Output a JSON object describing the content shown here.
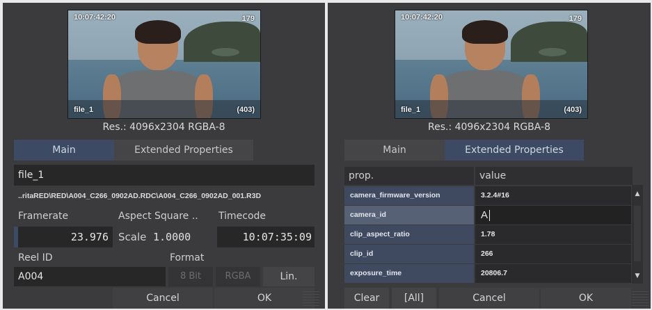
{
  "thumbnail": {
    "timecode": "10:07:42:20",
    "frame": "179",
    "clip_name": "file_1",
    "count": "(403)"
  },
  "resolution": "Res.: 4096x2304 RGBA-8",
  "tabs": {
    "main": "Main",
    "extended": "Extended Properties"
  },
  "main": {
    "clip_name": "file_1",
    "path": "..ritaRED\\RED\\A004_C266_0902AD.RDC\\A004_C266_0902AD_001.R3D",
    "framerate_label": "Framerate",
    "framerate_value": "23.976",
    "aspect_label": "Aspect Square ..",
    "scale_label": "Scale",
    "scale_value": "1.0000",
    "timecode_label": "Timecode",
    "timecode_value": "10:07:35:09",
    "reel_label": "Reel ID",
    "reel_value": "A004",
    "format_label": "Format",
    "format_bits": "8 Bit",
    "format_channels": "RGBA",
    "format_lin": "Lin."
  },
  "extended": {
    "header_prop": "prop.",
    "header_value": "value",
    "rows": [
      {
        "prop": "camera_firmware_version",
        "value": "3.2.4#16"
      },
      {
        "prop": "camera_id",
        "value": "A"
      },
      {
        "prop": "clip_aspect_ratio",
        "value": "1.78"
      },
      {
        "prop": "clip_id",
        "value": "266"
      },
      {
        "prop": "exposure_time",
        "value": "20806.7"
      }
    ],
    "clear_label": "Clear",
    "all_label": "[All]"
  },
  "buttons": {
    "cancel": "Cancel",
    "ok": "OK"
  },
  "colors": {
    "panel_bg": "#3b3b3e",
    "tab_active": "#3d4a63",
    "row_prop": "#3f4a61"
  }
}
